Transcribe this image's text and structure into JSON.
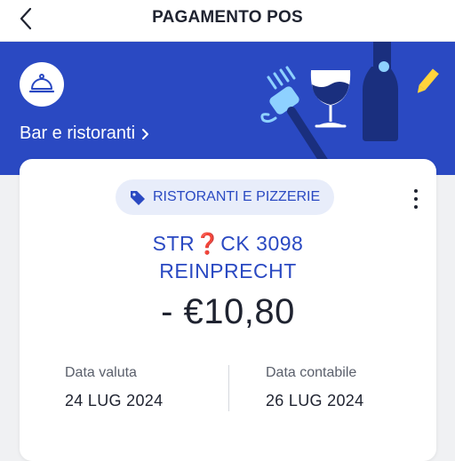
{
  "header": {
    "title": "PAGAMENTO POS"
  },
  "category": {
    "label": "Bar e ristoranti",
    "icon": "cloche-icon",
    "hero_color": "#2a49c2"
  },
  "transaction": {
    "tag": "RISTORANTI E PIZZERIE",
    "merchant_line1": "STR❓CK 3098",
    "merchant_line2": "REINPRECHT",
    "amount": "- €10,80",
    "value_date_label": "Data valuta",
    "value_date": "24 LUG 2024",
    "accounting_date_label": "Data contabile",
    "accounting_date": "26 LUG 2024"
  },
  "colors": {
    "accent": "#2a49c2",
    "tag_bg": "#e8edfa",
    "text": "#1f2330"
  }
}
